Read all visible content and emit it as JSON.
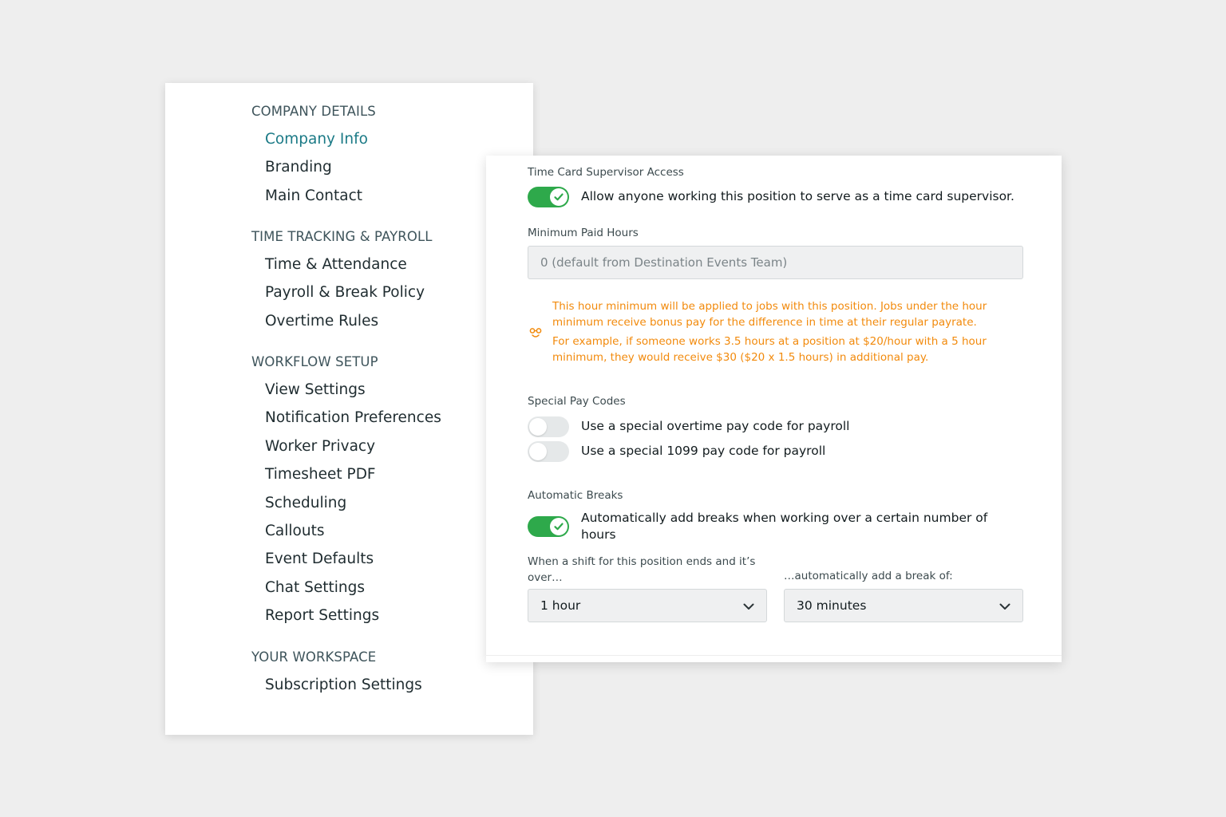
{
  "sidebar": {
    "sections": [
      {
        "header": "COMPANY DETAILS",
        "items": [
          {
            "label": "Company Info",
            "active": true
          },
          {
            "label": "Branding"
          },
          {
            "label": "Main Contact"
          }
        ]
      },
      {
        "header": "TIME TRACKING & PAYROLL",
        "items": [
          {
            "label": "Time & Attendance"
          },
          {
            "label": "Payroll & Break Policy"
          },
          {
            "label": "Overtime Rules"
          }
        ]
      },
      {
        "header": "WORKFLOW SETUP",
        "items": [
          {
            "label": "View Settings"
          },
          {
            "label": "Notification Preferences"
          },
          {
            "label": "Worker Privacy"
          },
          {
            "label": "Timesheet PDF"
          },
          {
            "label": "Scheduling"
          },
          {
            "label": "Callouts"
          },
          {
            "label": "Event Defaults"
          },
          {
            "label": "Chat Settings"
          },
          {
            "label": "Report Settings"
          }
        ]
      },
      {
        "header": "YOUR WORKSPACE",
        "items": [
          {
            "label": "Subscription Settings"
          }
        ]
      }
    ]
  },
  "panel": {
    "supervisor": {
      "label": "Time Card Supervisor Access",
      "toggle_text": "Allow anyone working this position to serve as a time card supervisor.",
      "enabled": true
    },
    "min_paid_hours": {
      "label": "Minimum Paid Hours",
      "placeholder": "0 (default from Destination Events Team)"
    },
    "info": {
      "icon": "hint-face-icon",
      "line1": "This hour minimum will be applied to jobs with this position. Jobs under the hour minimum receive bonus pay for the difference in time at their regular payrate.",
      "line2": "For example, if someone works 3.5 hours at a position at $20/hour with a 5 hour minimum, they would receive $30 ($20 x 1.5 hours) in additional pay."
    },
    "special_pay": {
      "label": "Special Pay Codes",
      "overtime_text": "Use a special overtime pay code for payroll",
      "overtime_enabled": false,
      "code1099_text": "Use a special 1099 pay code for payroll",
      "code1099_enabled": false
    },
    "auto_breaks": {
      "label": "Automatic Breaks",
      "toggle_text": "Automatically add breaks when working over a certain number of hours",
      "enabled": true,
      "shift_label": "When a shift for this position ends and it’s over…",
      "shift_value": "1 hour",
      "break_label": "…automatically add a break of:",
      "break_value": "30 minutes"
    }
  },
  "colors": {
    "accent": "#1b7a86",
    "toggle_on": "#2ea94b",
    "warning": "#f28a0c",
    "background": "#eeeeee"
  }
}
